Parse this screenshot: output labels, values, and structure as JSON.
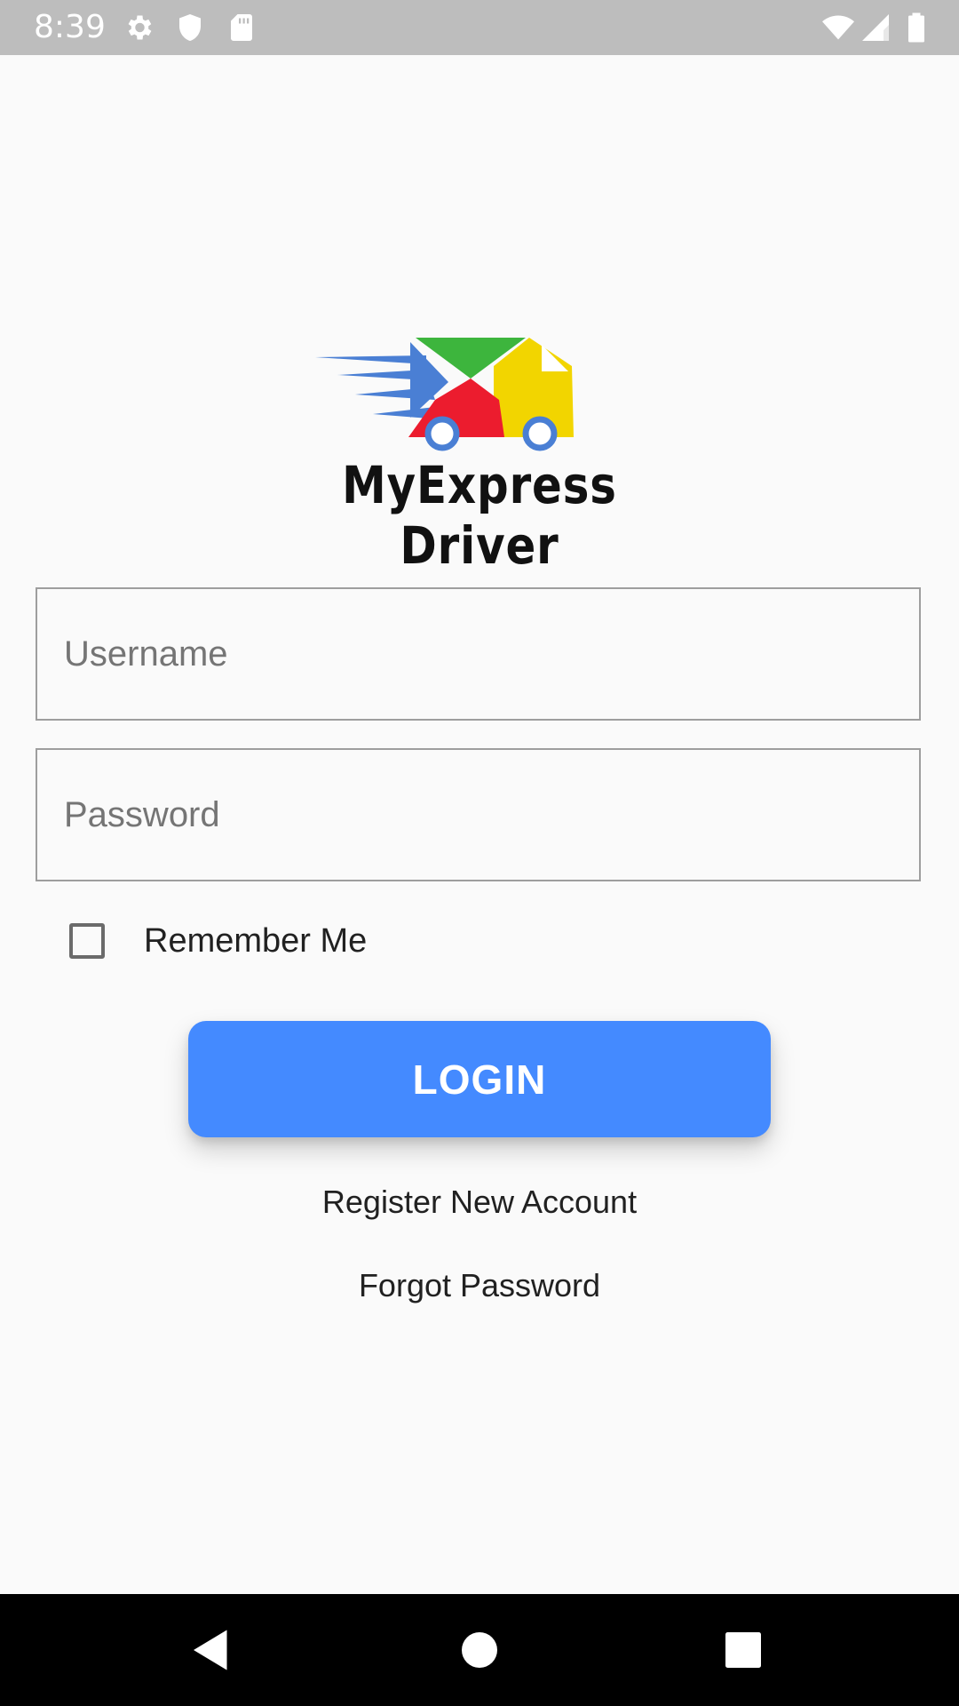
{
  "status_bar": {
    "time": "8:39",
    "icons": [
      "settings-gear-icon",
      "shield-icon",
      "sd-card-icon",
      "wifi-icon",
      "cell-signal-icon",
      "battery-icon"
    ]
  },
  "logo": {
    "text": "MyExpress Driver",
    "colors": [
      "#4a7fd4",
      "#3db53d",
      "#ec1c2e",
      "#f2d500"
    ]
  },
  "form": {
    "username_placeholder": "Username",
    "password_placeholder": "Password",
    "remember_label": "Remember Me",
    "remember_checked": false,
    "login_label": "LOGIN"
  },
  "links": {
    "register": "Register New Account",
    "forgot": "Forgot Password"
  },
  "nav_bar": {
    "icons": [
      "back-icon",
      "home-icon",
      "recents-icon"
    ]
  },
  "theme": {
    "accent": "#448aff",
    "background": "#fafafa"
  }
}
